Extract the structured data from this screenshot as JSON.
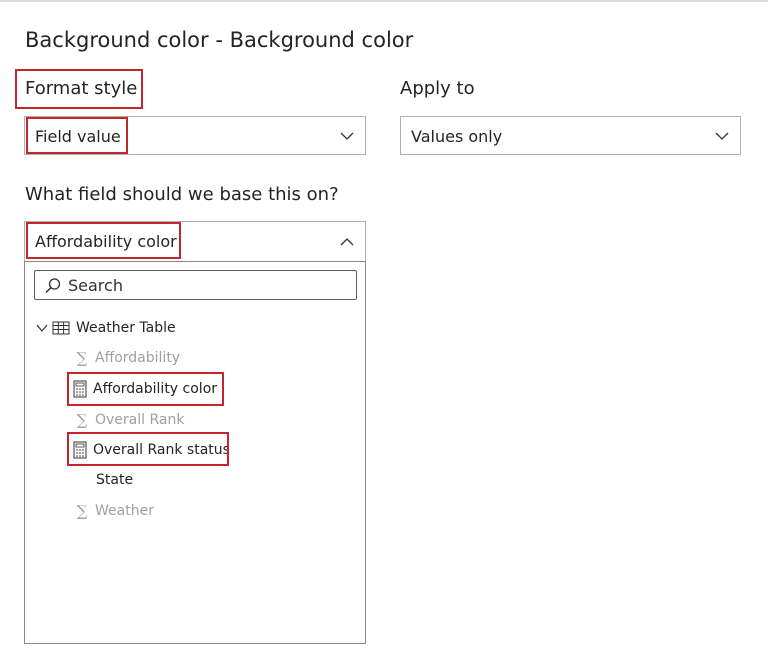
{
  "title": "Background color - Background color",
  "format_style": {
    "label": "Format style",
    "value": "Field value"
  },
  "apply_to": {
    "label": "Apply to",
    "value": "Values only"
  },
  "base_field": {
    "label": "What field should we base this on?",
    "value": "Affordability color"
  },
  "field_picker": {
    "search_placeholder": "Search",
    "table": {
      "name": "Weather Table",
      "icon": "table-icon",
      "fields": [
        {
          "name": "Affordability",
          "icon": "sigma-icon",
          "enabled": false
        },
        {
          "name": "Affordability color",
          "icon": "calculator-icon",
          "enabled": true
        },
        {
          "name": "Overall Rank",
          "icon": "sigma-icon",
          "enabled": false
        },
        {
          "name": "Overall Rank status",
          "icon": "calculator-icon",
          "enabled": true
        },
        {
          "name": "State",
          "icon": "",
          "enabled": true
        },
        {
          "name": "Weather",
          "icon": "sigma-icon",
          "enabled": false
        }
      ]
    }
  },
  "colors": {
    "highlight": "#c4262e",
    "disabled_text": "#a19f9d",
    "border": "#b3b0ad"
  }
}
